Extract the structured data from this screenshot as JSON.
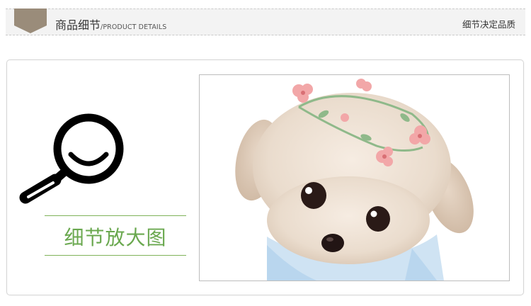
{
  "header": {
    "title": "商品细节",
    "subtitle": "/PRODUCT DETAILS",
    "right_text": "细节决定品质",
    "tag_color": "#9a8c7a"
  },
  "detail": {
    "caption": "细节放大图",
    "icon": "magnifier-icon",
    "accent_color": "#6aa84f"
  },
  "photo": {
    "subject": "illustrated-dog-with-flower-crown"
  }
}
